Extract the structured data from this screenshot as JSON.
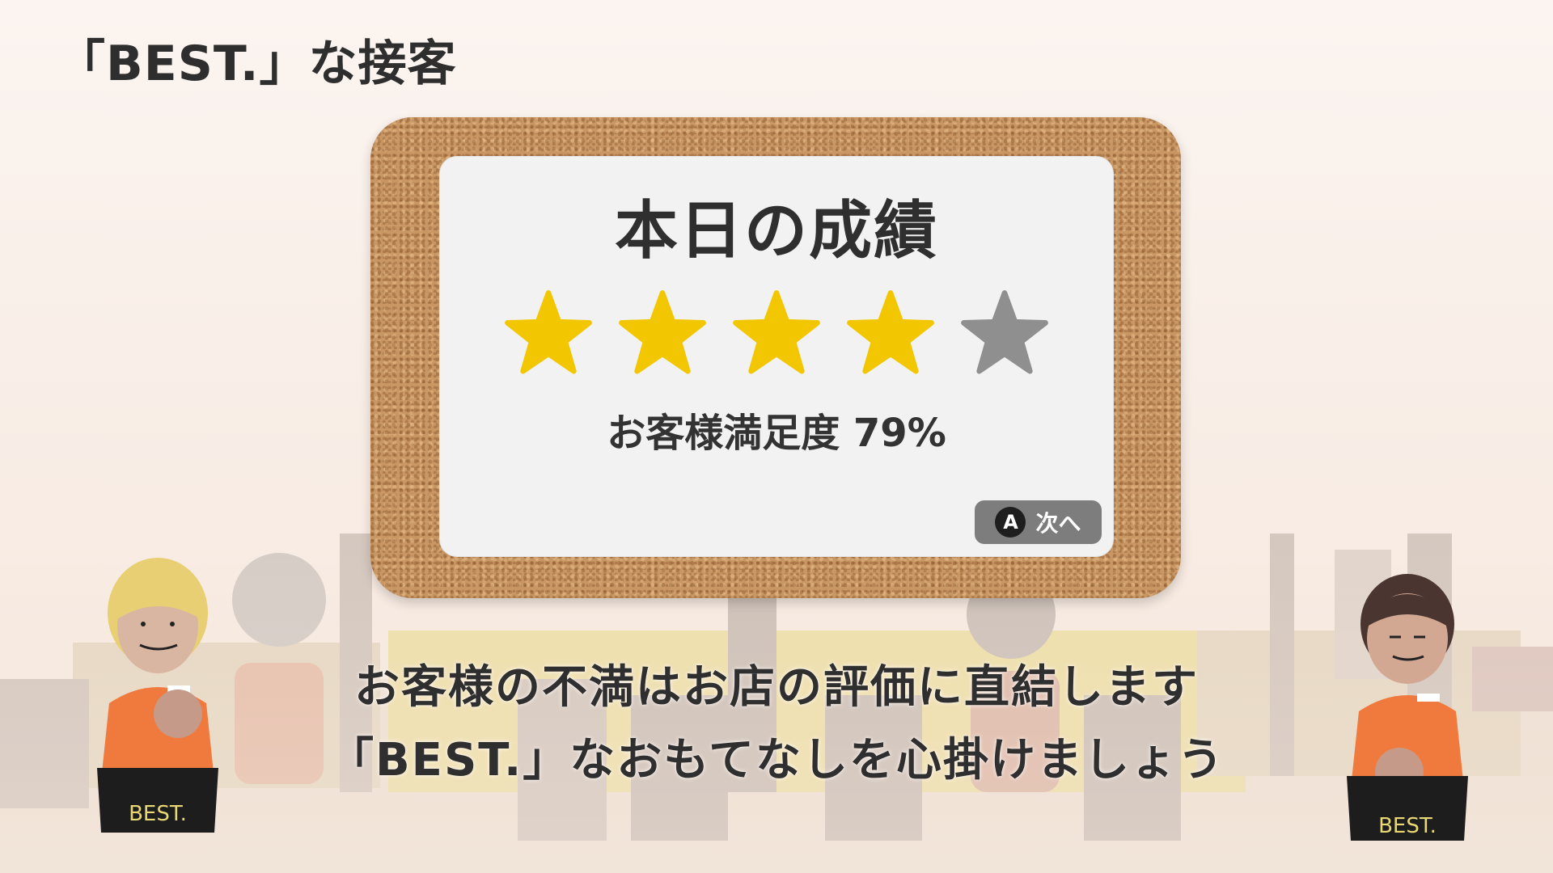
{
  "header": {
    "title": "「BEST.」な接客"
  },
  "result_card": {
    "title": "本日の成績",
    "rating": {
      "earned": 4,
      "total": 5
    },
    "satisfaction_text": "お客様満足度 79%",
    "next_button": {
      "key_icon": "A",
      "label": "次へ"
    }
  },
  "message": {
    "line1": "お客様の不満はお店の評価に直結します",
    "line2": "「BEST.」なおもてなしを心掛けましょう"
  },
  "characters": {
    "left_staff_apron": "BEST.",
    "right_staff_apron": "BEST."
  },
  "colors": {
    "star_filled": "#f2c600",
    "star_empty": "#8f8f8f",
    "uniform": "#f07a3e",
    "apron": "#1d1d1d",
    "cork": "#c99763"
  },
  "icons": [
    "star-icon",
    "a-button-icon"
  ]
}
